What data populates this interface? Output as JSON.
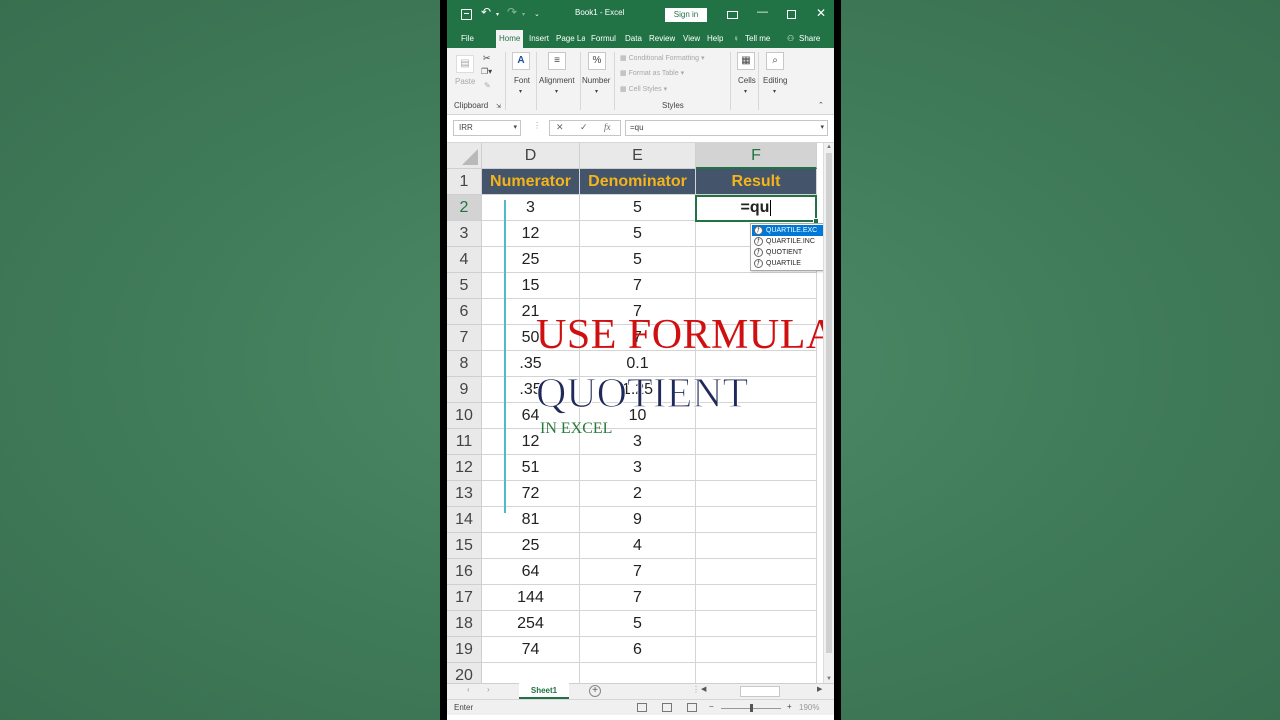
{
  "titlebar": {
    "doc_title": "Book1  -  Excel",
    "signin_label": "Sign in"
  },
  "tabs": [
    "File",
    "Home",
    "Insert",
    "Page La",
    "Formul",
    "Data",
    "Review",
    "View",
    "Help",
    "Tell me",
    "Share"
  ],
  "ribbon": {
    "paste": "Paste",
    "clipboard": "Clipboard",
    "font": "Font",
    "alignment": "Alignment",
    "number": "Number",
    "cond_format": "Conditional Formatting",
    "format_table": "Format as Table",
    "cell_styles": "Cell Styles",
    "styles": "Styles",
    "cells": "Cells",
    "editing": "Editing"
  },
  "formula_bar": {
    "name_box": "IRR",
    "formula": "=qu"
  },
  "columns": [
    "D",
    "E",
    "F"
  ],
  "header_row": {
    "num": "1",
    "d": "Numerator",
    "e": "Denominator",
    "f": "Result"
  },
  "rows": [
    {
      "num": "2",
      "d": "3",
      "e": "5",
      "f": "=qu"
    },
    {
      "num": "3",
      "d": "12",
      "e": "5",
      "f": ""
    },
    {
      "num": "4",
      "d": "25",
      "e": "5",
      "f": ""
    },
    {
      "num": "5",
      "d": "15",
      "e": "7",
      "f": ""
    },
    {
      "num": "6",
      "d": "21",
      "e": "7",
      "f": ""
    },
    {
      "num": "7",
      "d": "50",
      "e": "7",
      "f": ""
    },
    {
      "num": "8",
      "d": ".35",
      "e": "0.1",
      "f": ""
    },
    {
      "num": "9",
      "d": ".35",
      "e": "1.25",
      "f": ""
    },
    {
      "num": "10",
      "d": "64",
      "e": "10",
      "f": ""
    },
    {
      "num": "11",
      "d": "12",
      "e": "3",
      "f": ""
    },
    {
      "num": "12",
      "d": "51",
      "e": "3",
      "f": ""
    },
    {
      "num": "13",
      "d": "72",
      "e": "2",
      "f": ""
    },
    {
      "num": "14",
      "d": "81",
      "e": "9",
      "f": ""
    },
    {
      "num": "15",
      "d": "25",
      "e": "4",
      "f": ""
    },
    {
      "num": "16",
      "d": "64",
      "e": "7",
      "f": ""
    },
    {
      "num": "17",
      "d": "144",
      "e": "7",
      "f": ""
    },
    {
      "num": "18",
      "d": "254",
      "e": "5",
      "f": ""
    },
    {
      "num": "19",
      "d": "74",
      "e": "6",
      "f": ""
    },
    {
      "num": "20",
      "d": "",
      "e": "",
      "f": ""
    }
  ],
  "autocomplete": [
    "QUARTILE.EXC",
    "QUARTILE.INC",
    "QUOTIENT",
    "QUARTILE"
  ],
  "overlay": {
    "line1": "USE FORMULA",
    "line2": "QUOTIENT",
    "line3": "IN EXCEL"
  },
  "sheet_tab": "Sheet1",
  "status": {
    "mode": "Enter",
    "zoom": "190%"
  },
  "colors": {
    "excel_green": "#217346",
    "header_fill": "#44546a",
    "header_text": "#f4b41a",
    "overlay_red": "#d01010",
    "overlay_navy": "#1f2a5a",
    "overlay_green": "#2a7a3a"
  }
}
